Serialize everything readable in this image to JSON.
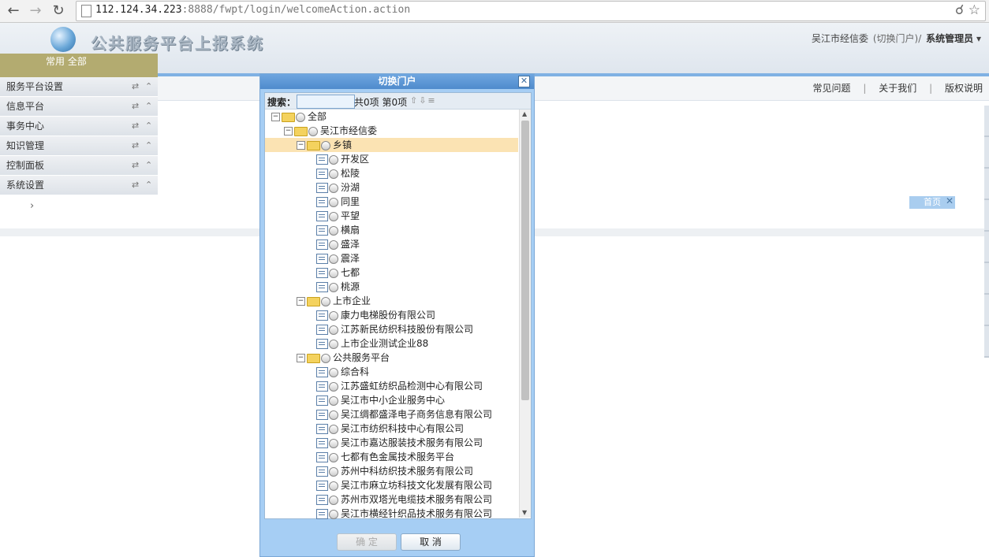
{
  "browser": {
    "url_host": "112.124.34.223",
    "url_rest": ":8888/fwpt/login/welcomeAction.action"
  },
  "header": {
    "logo_text": "公共服务平台上报系统",
    "org": "吴江市经信委",
    "switch_portal": "(切换门户)/",
    "role": "系统管理员"
  },
  "top_links": [
    "常见问题",
    "关于我们",
    "版权说明"
  ],
  "sidebar": {
    "tabs": "常用  全部",
    "items": [
      {
        "label": "服务平台设置"
      },
      {
        "label": "信息平台"
      },
      {
        "label": "事务中心"
      },
      {
        "label": "知识管理"
      },
      {
        "label": "控制面板"
      },
      {
        "label": "系统设置"
      }
    ]
  },
  "home_tab": {
    "label": "首页"
  },
  "dialog": {
    "title": "切换门户",
    "search_label": "搜索：",
    "search_value": "",
    "count_text": "共0项 第0项",
    "confirm_label": "确 定",
    "cancel_label": "取 消",
    "tree": [
      {
        "label": "全部",
        "level": 0,
        "type": "folder",
        "expanded": true
      },
      {
        "label": "吴江市经信委",
        "level": 1,
        "type": "folder",
        "expanded": true
      },
      {
        "label": "乡镇",
        "level": 2,
        "type": "folder",
        "expanded": true,
        "selected": true
      },
      {
        "label": "开发区",
        "level": 3,
        "type": "leaf"
      },
      {
        "label": "松陵",
        "level": 3,
        "type": "leaf"
      },
      {
        "label": "汾湖",
        "level": 3,
        "type": "leaf"
      },
      {
        "label": "同里",
        "level": 3,
        "type": "leaf"
      },
      {
        "label": "平望",
        "level": 3,
        "type": "leaf"
      },
      {
        "label": "横扇",
        "level": 3,
        "type": "leaf"
      },
      {
        "label": "盛泽",
        "level": 3,
        "type": "leaf"
      },
      {
        "label": "震泽",
        "level": 3,
        "type": "leaf"
      },
      {
        "label": "七都",
        "level": 3,
        "type": "leaf"
      },
      {
        "label": "桃源",
        "level": 3,
        "type": "leaf"
      },
      {
        "label": "上市企业",
        "level": 2,
        "type": "folder",
        "expanded": true
      },
      {
        "label": "康力电梯股份有限公司",
        "level": 3,
        "type": "leaf"
      },
      {
        "label": "江苏新民纺织科技股份有限公司",
        "level": 3,
        "type": "leaf"
      },
      {
        "label": "上市企业测试企业88",
        "level": 3,
        "type": "leaf"
      },
      {
        "label": "公共服务平台",
        "level": 2,
        "type": "folder",
        "expanded": true
      },
      {
        "label": "综合科",
        "level": 3,
        "type": "leaf"
      },
      {
        "label": "江苏盛虹纺织品检测中心有限公司",
        "level": 3,
        "type": "leaf"
      },
      {
        "label": "吴江市中小企业服务中心",
        "level": 3,
        "type": "leaf"
      },
      {
        "label": "吴江绸都盛泽电子商务信息有限公司",
        "level": 3,
        "type": "leaf"
      },
      {
        "label": "吴江市纺织科技中心有限公司",
        "level": 3,
        "type": "leaf"
      },
      {
        "label": "吴江市嘉达服装技术服务有限公司",
        "level": 3,
        "type": "leaf"
      },
      {
        "label": "七都有色金属技术服务平台",
        "level": 3,
        "type": "leaf"
      },
      {
        "label": "苏州中科纺织技术服务有限公司",
        "level": 3,
        "type": "leaf"
      },
      {
        "label": "吴江市麻立坊科技文化发展有限公司",
        "level": 3,
        "type": "leaf"
      },
      {
        "label": "苏州市双塔光电缆技术服务有限公司",
        "level": 3,
        "type": "leaf"
      },
      {
        "label": "吴江市横经针织品技术服务有限公司",
        "level": 3,
        "type": "leaf"
      }
    ]
  }
}
